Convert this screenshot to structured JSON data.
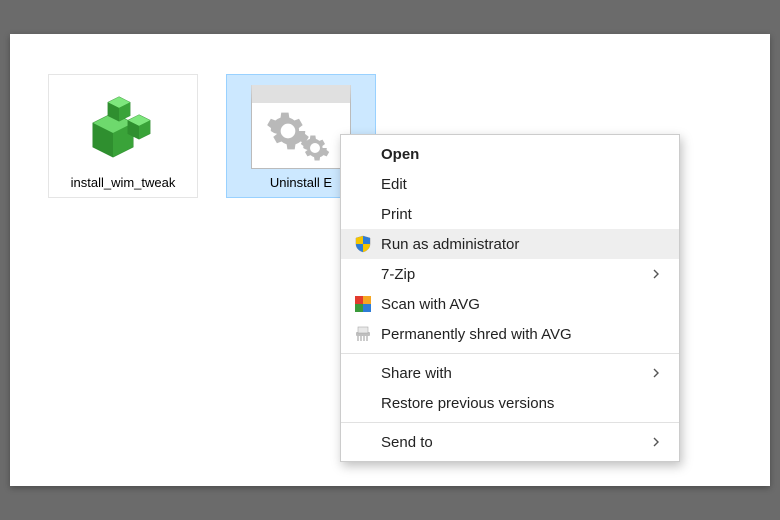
{
  "files": {
    "install_wim_tweak": {
      "label": "install_wim_tweak"
    },
    "uninstall_edge": {
      "label": "Uninstall E"
    }
  },
  "context_menu": {
    "open": "Open",
    "edit": "Edit",
    "print": "Print",
    "run_as_admin": "Run as administrator",
    "seven_zip": "7-Zip",
    "scan_avg": "Scan with AVG",
    "shred_avg": "Permanently shred with AVG",
    "share_with": "Share with",
    "restore_versions": "Restore previous versions",
    "send_to": "Send to"
  },
  "colors": {
    "selection_bg": "#cce8ff",
    "selection_border": "#99d1ff",
    "menu_hover": "#eeeeee"
  }
}
